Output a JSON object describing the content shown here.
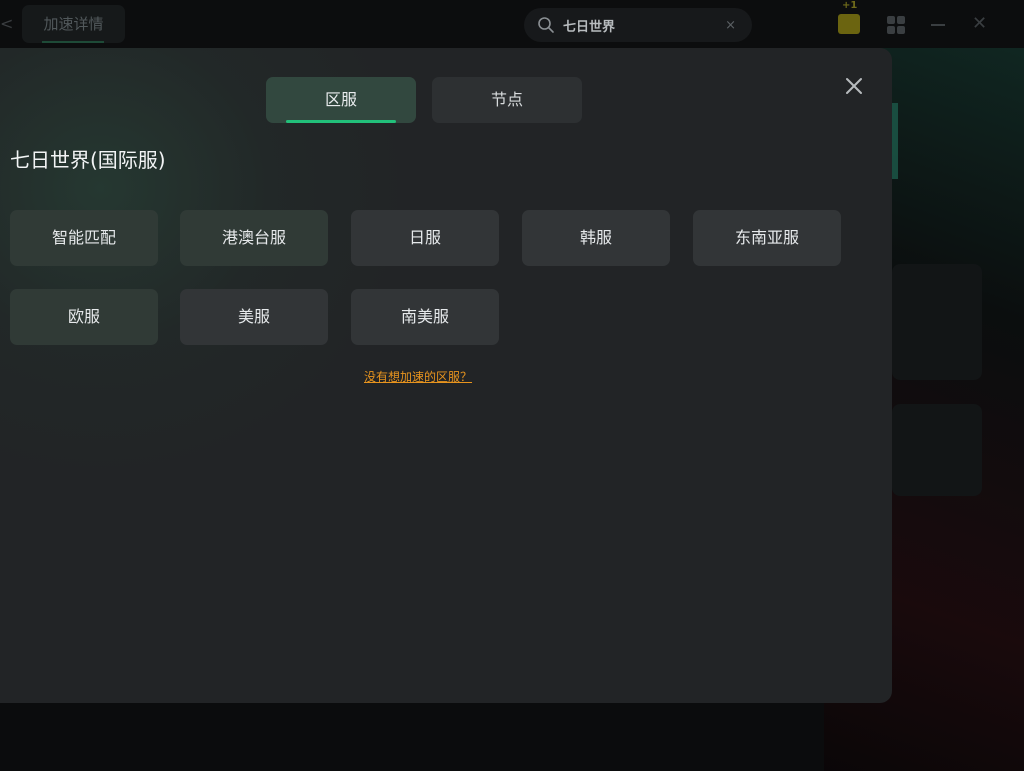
{
  "topbar": {
    "back_glyph": "<",
    "tab_label": "加速详情",
    "search": {
      "value": "七日世界",
      "clear_glyph": "×"
    },
    "gift_badge": "+1",
    "close_glyph": "✕"
  },
  "modal": {
    "close_glyph": "✕",
    "segments": [
      {
        "label": "区服",
        "active": true
      },
      {
        "label": "节点",
        "active": false
      }
    ],
    "game_title": "七日世界(国际服)",
    "options": [
      {
        "label": "智能匹配"
      },
      {
        "label": "港澳台服"
      },
      {
        "label": "日服"
      },
      {
        "label": "韩服"
      },
      {
        "label": "东南亚服"
      },
      {
        "label": "欧服"
      },
      {
        "label": "美服"
      },
      {
        "label": "南美服"
      }
    ],
    "feedback_link": "没有想加速的区服？"
  },
  "colors": {
    "accent": "#22c07a",
    "link": "#e8941e",
    "modal_bg": "#222426"
  }
}
